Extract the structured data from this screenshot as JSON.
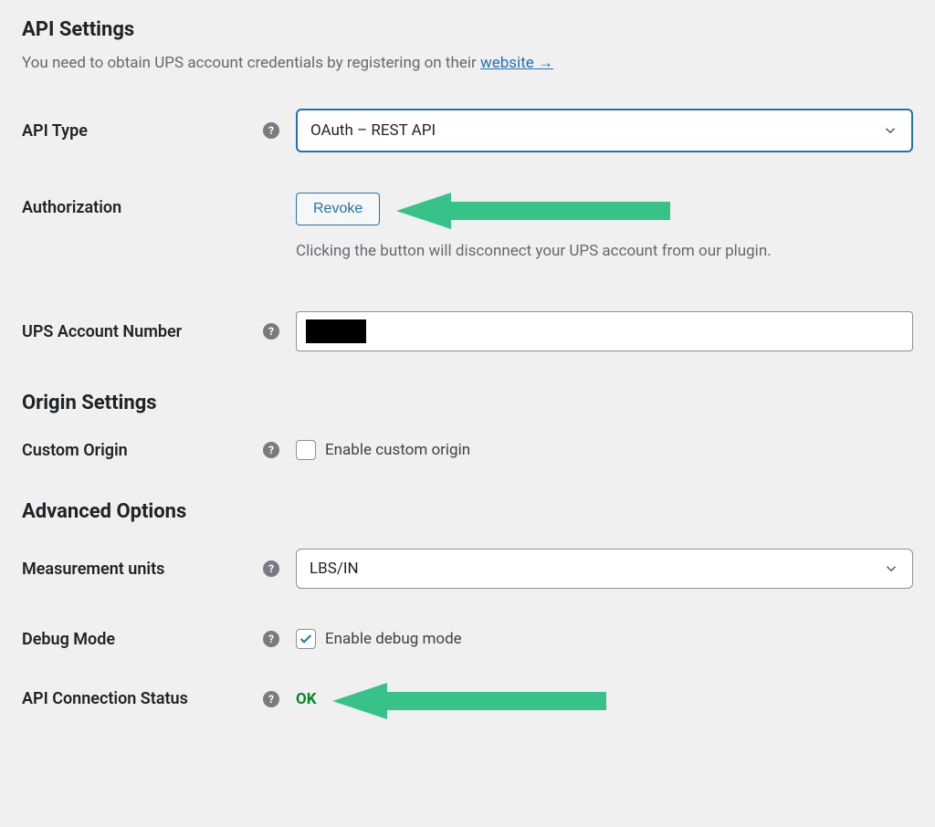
{
  "sections": {
    "api": {
      "title": "API Settings",
      "description_pre": "You need to obtain UPS account credentials by registering on their ",
      "link_text": "website",
      "link_arrow": "→"
    },
    "origin": {
      "title": "Origin Settings"
    },
    "advanced": {
      "title": "Advanced Options"
    }
  },
  "fields": {
    "api_type": {
      "label": "API Type",
      "value": "OAuth – REST API"
    },
    "authorization": {
      "label": "Authorization",
      "button": "Revoke",
      "description": "Clicking the button will disconnect your UPS account from our plugin."
    },
    "account_number": {
      "label": "UPS Account Number",
      "value": ""
    },
    "custom_origin": {
      "label": "Custom Origin",
      "checkbox_label": "Enable custom origin",
      "checked": false
    },
    "measurement_units": {
      "label": "Measurement units",
      "value": "LBS/IN"
    },
    "debug_mode": {
      "label": "Debug Mode",
      "checkbox_label": "Enable debug mode",
      "checked": true
    },
    "connection_status": {
      "label": "API Connection Status",
      "value": "OK"
    }
  }
}
